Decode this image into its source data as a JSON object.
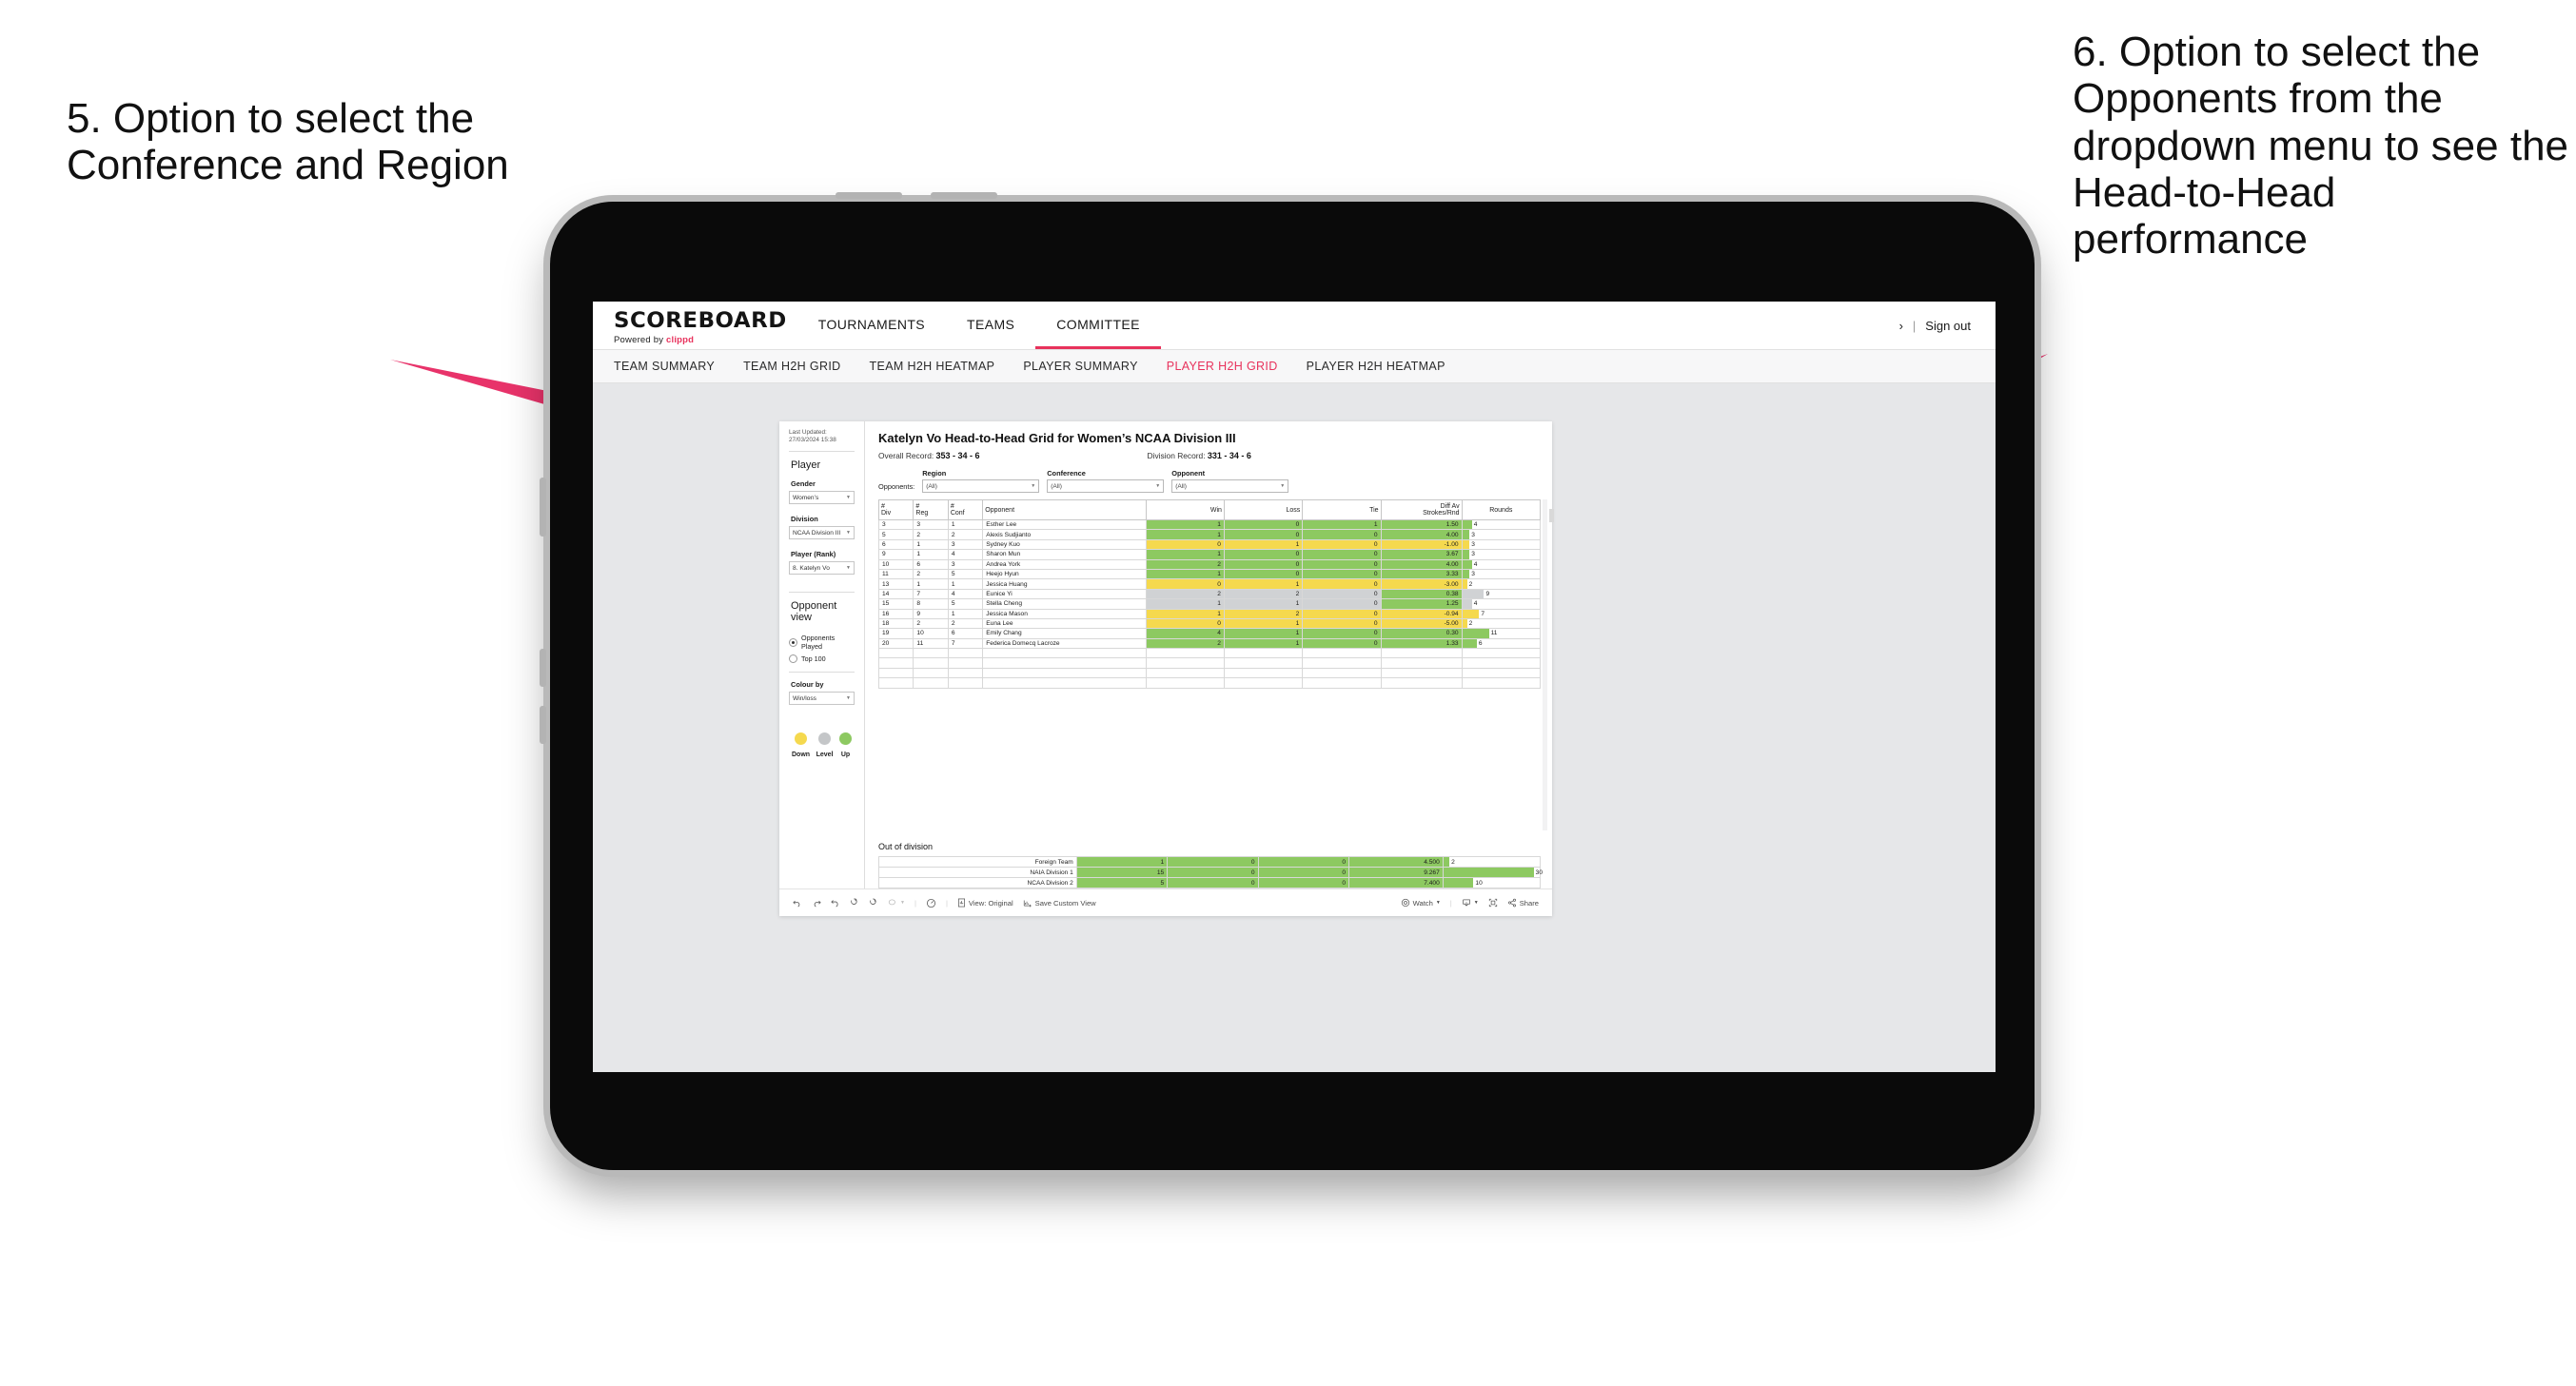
{
  "annotations": {
    "left": "5. Option to select the Conference and Region",
    "right": "6. Option to select the Opponents from the dropdown menu to see the Head-to-Head performance",
    "arrow_color": "#e8336a"
  },
  "app": {
    "logo": {
      "word": "SCOREBOARD",
      "powered_prefix": "Powered by ",
      "brand": "clippd"
    },
    "main_nav": [
      {
        "label": "TOURNAMENTS",
        "active": false
      },
      {
        "label": "TEAMS",
        "active": false
      },
      {
        "label": "COMMITTEE",
        "active": true
      }
    ],
    "header_right": {
      "chevron": "›",
      "separator": "|",
      "sign_out": "Sign out"
    },
    "sub_nav": [
      {
        "label": "TEAM SUMMARY",
        "active": false
      },
      {
        "label": "TEAM H2H GRID",
        "active": false
      },
      {
        "label": "TEAM H2H HEATMAP",
        "active": false
      },
      {
        "label": "PLAYER SUMMARY",
        "active": false
      },
      {
        "label": "PLAYER H2H GRID",
        "active": true
      },
      {
        "label": "PLAYER H2H HEATMAP",
        "active": false
      }
    ],
    "accent_color": "#e8325c"
  },
  "sidebar": {
    "last_updated": "Last Updated: 27/03/2024 15:38",
    "player_heading": "Player",
    "gender": {
      "label": "Gender",
      "value": "Women’s"
    },
    "division": {
      "label": "Division",
      "value": "NCAA Division III"
    },
    "player_rank": {
      "label": "Player (Rank)",
      "value": "8. Katelyn Vo"
    },
    "opponent_view": {
      "heading": "Opponent view",
      "options": [
        {
          "label": "Opponents Played",
          "selected": true
        },
        {
          "label": "Top 100",
          "selected": false
        }
      ]
    },
    "colour_by": {
      "label": "Colour by",
      "value": "Win/loss"
    },
    "legend": [
      {
        "label": "Down",
        "color": "#f5d94e"
      },
      {
        "label": "Level",
        "color": "#c4c6c8"
      },
      {
        "label": "Up",
        "color": "#8dc961"
      }
    ]
  },
  "view": {
    "title": "Katelyn Vo Head-to-Head Grid for Women’s NCAA Division III",
    "overall_record": {
      "label": "Overall Record: ",
      "value": "353 - 34 - 6"
    },
    "division_record": {
      "label": "Division Record: ",
      "value": "331 -  34 - 6"
    },
    "filters": {
      "prefix": "Opponents:",
      "items": [
        {
          "label": "Region",
          "value": "(All)"
        },
        {
          "label": "Conference",
          "value": "(All)"
        },
        {
          "label": "Opponent",
          "value": "(All)"
        }
      ]
    }
  },
  "chart_data": {
    "type": "table",
    "title": "Katelyn Vo Head-to-Head Grid for Women’s NCAA Division III",
    "columns": [
      "# Div",
      "# Reg",
      "# Conf",
      "Opponent",
      "Win",
      "Loss",
      "Tie",
      "Diff Av Strokes/Rnd",
      "Rounds"
    ],
    "column_headers_two_line": [
      {
        "top": "#",
        "bottom": "Div"
      },
      {
        "top": "#",
        "bottom": "Reg"
      },
      {
        "top": "#",
        "bottom": "Conf"
      },
      {
        "top": "Opponent",
        "bottom": ""
      },
      {
        "top": "Win",
        "bottom": ""
      },
      {
        "top": "Loss",
        "bottom": ""
      },
      {
        "top": "Tie",
        "bottom": ""
      },
      {
        "top": "Diff Av",
        "bottom": "Strokes/Rnd"
      },
      {
        "top": "Rounds",
        "bottom": ""
      }
    ],
    "colors": {
      "up": "#8dc961",
      "down": "#f5d94e",
      "level": "#d0d2d4"
    },
    "rounds_axis_max": 32,
    "rows": [
      {
        "div": "3",
        "reg": "3",
        "conf": "1",
        "opponent": "Esther Lee",
        "win": "1",
        "loss": "0",
        "tie": "1",
        "diff": "1.50",
        "rounds": "4",
        "state": "up"
      },
      {
        "div": "5",
        "reg": "2",
        "conf": "2",
        "opponent": "Alexis Sudjianto",
        "win": "1",
        "loss": "0",
        "tie": "0",
        "diff": "4.00",
        "rounds": "3",
        "state": "up"
      },
      {
        "div": "6",
        "reg": "1",
        "conf": "3",
        "opponent": "Sydney Kuo",
        "win": "0",
        "loss": "1",
        "tie": "0",
        "diff": "-1.00",
        "rounds": "3",
        "state": "down"
      },
      {
        "div": "9",
        "reg": "1",
        "conf": "4",
        "opponent": "Sharon Mun",
        "win": "1",
        "loss": "0",
        "tie": "0",
        "diff": "3.67",
        "rounds": "3",
        "state": "up"
      },
      {
        "div": "10",
        "reg": "6",
        "conf": "3",
        "opponent": "Andrea York",
        "win": "2",
        "loss": "0",
        "tie": "0",
        "diff": "4.00",
        "rounds": "4",
        "state": "up"
      },
      {
        "div": "11",
        "reg": "2",
        "conf": "5",
        "opponent": "Heejo Hyun",
        "win": "1",
        "loss": "0",
        "tie": "0",
        "diff": "3.33",
        "rounds": "3",
        "state": "up"
      },
      {
        "div": "13",
        "reg": "1",
        "conf": "1",
        "opponent": "Jessica Huang",
        "win": "0",
        "loss": "1",
        "tie": "0",
        "diff": "-3.00",
        "rounds": "2",
        "state": "down"
      },
      {
        "div": "14",
        "reg": "7",
        "conf": "4",
        "opponent": "Eunice Yi",
        "win": "2",
        "loss": "2",
        "tie": "0",
        "diff": "0.38",
        "rounds": "9",
        "state": "level",
        "diff_state": "up"
      },
      {
        "div": "15",
        "reg": "8",
        "conf": "5",
        "opponent": "Stella Cheng",
        "win": "1",
        "loss": "1",
        "tie": "0",
        "diff": "1.25",
        "rounds": "4",
        "state": "level",
        "diff_state": "up"
      },
      {
        "div": "16",
        "reg": "9",
        "conf": "1",
        "opponent": "Jessica Mason",
        "win": "1",
        "loss": "2",
        "tie": "0",
        "diff": "-0.94",
        "rounds": "7",
        "state": "down"
      },
      {
        "div": "18",
        "reg": "2",
        "conf": "2",
        "opponent": "Euna Lee",
        "win": "0",
        "loss": "1",
        "tie": "0",
        "diff": "-5.00",
        "rounds": "2",
        "state": "down"
      },
      {
        "div": "19",
        "reg": "10",
        "conf": "6",
        "opponent": "Emily Chang",
        "win": "4",
        "loss": "1",
        "tie": "0",
        "diff": "0.30",
        "rounds": "11",
        "state": "up"
      },
      {
        "div": "20",
        "reg": "11",
        "conf": "7",
        "opponent": "Federica Domecq Lacroze",
        "win": "2",
        "loss": "1",
        "tie": "0",
        "diff": "1.33",
        "rounds": "6",
        "state": "up"
      }
    ]
  },
  "out_of_division": {
    "title": "Out of division",
    "rows": [
      {
        "name": "Foreign Team",
        "win": "1",
        "loss": "0",
        "tie": "0",
        "diff": "4.500",
        "rounds": "2",
        "state": "up"
      },
      {
        "name": "NAIA Division 1",
        "win": "15",
        "loss": "0",
        "tie": "0",
        "diff": "9.267",
        "rounds": "30",
        "state": "up"
      },
      {
        "name": "NCAA Division 2",
        "win": "5",
        "loss": "0",
        "tie": "0",
        "diff": "7.400",
        "rounds": "10",
        "state": "up"
      }
    ]
  },
  "toolbar": {
    "view_original": "View: Original",
    "save_custom_view": "Save Custom View",
    "watch": "Watch",
    "share": "Share"
  }
}
